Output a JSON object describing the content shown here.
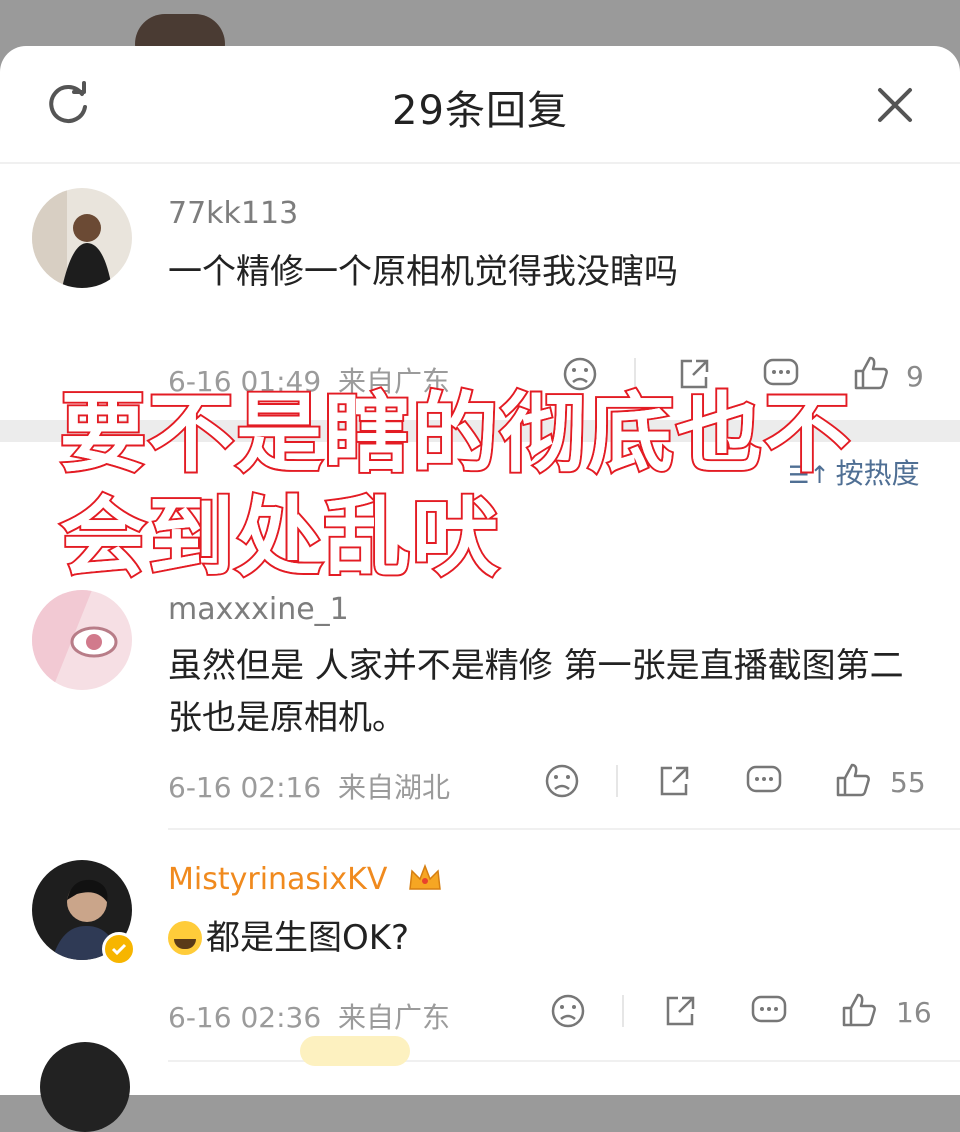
{
  "sheet": {
    "title": "29条回复"
  },
  "sort": {
    "label": "按热度",
    "icon": "sort-icon"
  },
  "overlay": {
    "line1": "要不是瞎的彻底也不",
    "line2": "会到处乱吠"
  },
  "comments": [
    {
      "username": "77kk113",
      "text": "一个精修一个原相机觉得我没瞎吗",
      "time": "6-16 01:49",
      "location": "来自广东",
      "likes": "9"
    },
    {
      "username": "maxxxine_1",
      "text": "虽然但是 人家并不是精修 第一张是直播截图第二张也是原相机。",
      "time": "6-16 02:16",
      "location": "来自湖北",
      "likes": "55"
    },
    {
      "username": "MistyrinasixKV",
      "text": "都是生图OK?",
      "time": "6-16 02:36",
      "location": "来自广东",
      "likes": "16"
    }
  ],
  "colors": {
    "accent_red": "#e8222b",
    "vip_gold": "#f08a1e",
    "link_blue": "#4f6f94"
  }
}
